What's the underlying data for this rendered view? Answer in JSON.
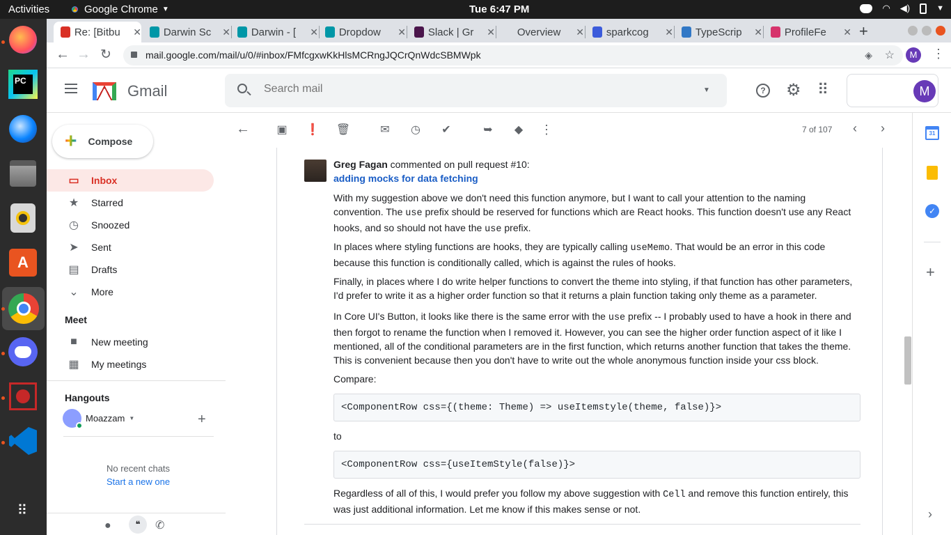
{
  "system": {
    "activities": "Activities",
    "app_name": "Google Chrome",
    "clock": "Tue  6:47 PM"
  },
  "dock": [
    "firefox-icon",
    "pycharm-icon",
    "thunderbird-icon",
    "files-icon",
    "rhythmbox-icon",
    "software-center-icon",
    "chrome-icon",
    "discord-icon",
    "screen-recorder-icon",
    "vscode-icon",
    "app-grid-icon"
  ],
  "tabs": [
    {
      "label": "Re: [Bitbu",
      "color": "#d93025",
      "active": true
    },
    {
      "label": "Darwin Sc",
      "color": "#0097a7"
    },
    {
      "label": "Darwin - [",
      "color": "#0097a7"
    },
    {
      "label": "Dropdow",
      "color": "#0097a7"
    },
    {
      "label": "Slack | Gr",
      "color": "#4a154b"
    },
    {
      "label": "Overview",
      "color": "#dee1e6"
    },
    {
      "label": "sparkcog",
      "color": "#3b5bdb"
    },
    {
      "label": "TypeScrip",
      "color": "#3178c6"
    },
    {
      "label": "ProfileFe",
      "color": "#d6336c"
    }
  ],
  "url": "mail.google.com/mail/u/0/#inbox/FMfcgxwKkHlsMCRngJQCrQnWdcSBMWpk",
  "gmail": {
    "logo_text": "Gmail",
    "search_placeholder": "Search mail",
    "avatar_letter": "M",
    "compose": "Compose",
    "nav": [
      {
        "label": "Inbox",
        "icon": "inbox-icon"
      },
      {
        "label": "Starred",
        "icon": "star-icon"
      },
      {
        "label": "Snoozed",
        "icon": "clock-icon"
      },
      {
        "label": "Sent",
        "icon": "send-icon"
      },
      {
        "label": "Drafts",
        "icon": "draft-icon"
      },
      {
        "label": "More",
        "icon": "chevron-down-icon"
      }
    ],
    "meet_title": "Meet",
    "meet": [
      {
        "label": "New meeting"
      },
      {
        "label": "My meetings"
      }
    ],
    "hangouts_title": "Hangouts",
    "hangouts_user": "Moazzam",
    "no_chats": "No recent chats",
    "start_new": "Start a new one",
    "pager": "7 of 107"
  },
  "email": {
    "sender": "Greg Fagan",
    "action": " commented on pull request #10:",
    "link": "adding mocks for data fetching",
    "p1a": "With my suggestion above we don't need this function anymore, but I want to call your attention to the naming convention. The ",
    "c_use": "use",
    "p1b": " prefix should be reserved for functions which are React hooks. This function doesn't use any React hooks, and so should not have the ",
    "p1c": " prefix.",
    "p2a": "In places where styling functions are hooks, they are typically calling ",
    "c_usememo": "useMemo",
    "p2b": ". That would be an error in this code because this function is conditionally called, which is against the rules of hooks.",
    "p3": "Finally, in places where I do write helper functions to convert the theme into styling, if that function has other parameters, I'd prefer to write it as a higher order function so that it returns a plain function taking only theme as a parameter.",
    "p4a": "In Core UI's Button, it looks like there is the same error with the ",
    "p4b": " prefix -- I probably used to have a hook in there and then forgot to rename the function when I removed it. However, you can see the higher order function aspect of it like I mentioned, all of the conditional parameters are in the first function, which returns another function that takes the theme. This is convenient because then you don't have to write out the whole anonymous function inside your css block.",
    "compare": "Compare:",
    "code1": "<ComponentRow css={(theme: Theme) => useItemstyle(theme, false)}>",
    "to": "to",
    "code2": "<ComponentRow css={useItemStyle(false)}>",
    "p5a": "Regardless of all of this, I would prefer you follow my above suggestion with ",
    "c_cell": "Cell",
    "p5b": " and remove this function entirely, this was just additional information. Let me know if this makes sense or not."
  },
  "colors": {
    "accent": "#d93025",
    "link": "#1a73e8",
    "avatar": "#673ab7"
  }
}
